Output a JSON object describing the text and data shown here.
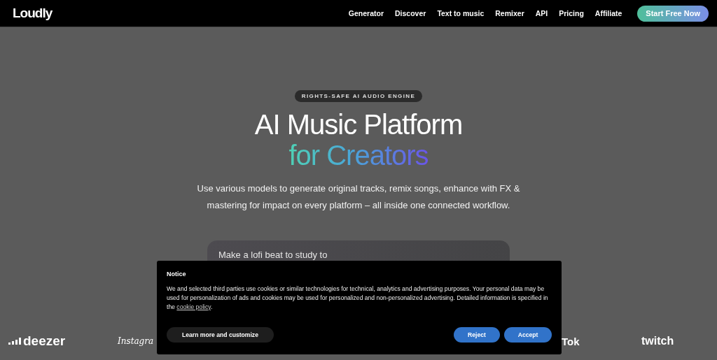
{
  "nav": {
    "logo": "Loudly",
    "links": [
      "Generator",
      "Discover",
      "Text to music",
      "Remixer",
      "API",
      "Pricing",
      "Affiliate"
    ],
    "cta": "Start Free Now"
  },
  "hero": {
    "badge": "RIGHTS-SAFE AI AUDIO ENGINE",
    "title": "AI Music Platform",
    "title_accent": "for Creators",
    "subtitle": "Use various models to generate original tracks, remix songs, enhance with FX & mastering for impact on every platform – all inside one connected workflow.",
    "prompt": {
      "value": "Make a lofi beat to study to"
    }
  },
  "partners": [
    "deezer",
    "Instagra",
    "Tok",
    "twitch"
  ],
  "cookie_notice": {
    "title": "Notice",
    "text": "We and selected third parties use cookies or similar technologies for technical, analytics and advertising purposes. Your personal data may be used for personalization of ads and cookies may be used for personalized and non-personalized advertising. Detailed information is specified in the",
    "link": "cookie policy",
    "after": ".",
    "buttons": [
      {
        "label": "Learn more and customize",
        "kind": "secondary"
      },
      {
        "label": "Reject",
        "kind": "primary"
      },
      {
        "label": "Accept",
        "kind": "primary"
      }
    ]
  }
}
